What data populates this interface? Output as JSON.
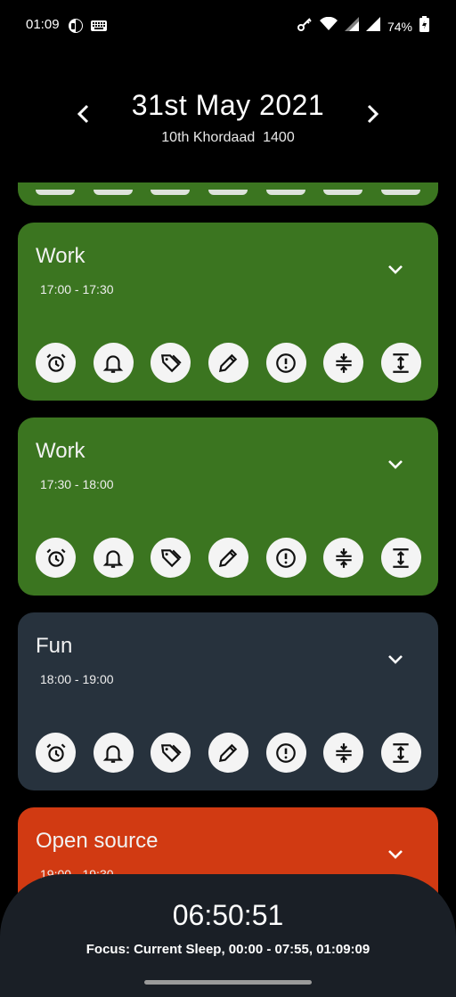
{
  "status_bar": {
    "time": "01:09",
    "battery_percent": "74%"
  },
  "header": {
    "date": "31st May 2021",
    "alt_date": "10th Khordaad  1400"
  },
  "colors": {
    "work_green": "#3b7520",
    "fun_slate": "#27323d",
    "open_source_orange": "#d13a12",
    "focus_panel": "#1a1f26"
  },
  "cards": [
    {
      "title": "Work",
      "time": "17:00 - 17:30"
    },
    {
      "title": "Work",
      "time": "17:30 - 18:00"
    },
    {
      "title": "Fun",
      "time": "18:00 - 19:00"
    },
    {
      "title": "Open source",
      "time": "19:00 - 19:30"
    }
  ],
  "action_icons": [
    "alarm-icon",
    "bell-icon",
    "tag-icon",
    "pencil-icon",
    "alert-circle-icon",
    "compress-icon",
    "expand-icon"
  ],
  "focus": {
    "countdown": "06:50:51",
    "text": "Focus: Current Sleep, 00:00 - 07:55, 01:09:09"
  }
}
